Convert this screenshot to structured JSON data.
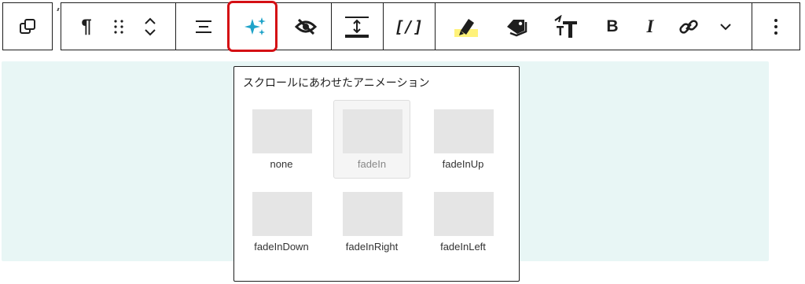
{
  "toolbar": {
    "paragraph_symbol": "¶",
    "bold_label": "B",
    "italic_label": "I",
    "code_label": "[/]",
    "icons": [
      "duplicate-icon",
      "paragraph-icon",
      "drag-handle-icon",
      "move-up-icon",
      "move-down-icon",
      "align-icon",
      "animation-sparkles-icon",
      "hide-icon",
      "spacing-icon",
      "code-icon",
      "highlighter-icon",
      "tag-icon",
      "text-size-icon",
      "bold-icon",
      "italic-icon",
      "link-icon",
      "chevron-down-icon",
      "more-options-icon"
    ],
    "accent_color": "#1fa3c9",
    "selected_ring_color": "#d40f14",
    "highlight_color": "#fff27a"
  },
  "popover": {
    "title": "スクロールにあわせたアニメーション",
    "selected": "fadeIn",
    "options": [
      {
        "label": "none"
      },
      {
        "label": "fadeIn"
      },
      {
        "label": "fadeInUp"
      },
      {
        "label": "fadeInDown"
      },
      {
        "label": "fadeInRight"
      },
      {
        "label": "fadeInLeft"
      }
    ]
  },
  "content_area_color": "#e8f6f5"
}
